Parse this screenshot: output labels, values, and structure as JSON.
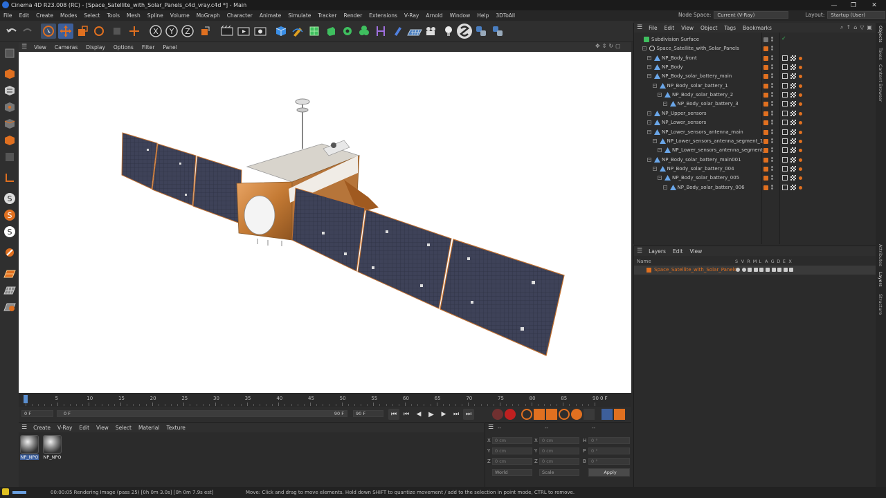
{
  "titlebar": {
    "title": "Cinema 4D R23.008 (RC) - [Space_Satellite_with_Solar_Panels_c4d_vray.c4d *] - Main",
    "minimize": "—",
    "maximize": "❐",
    "close": "✕"
  },
  "menubar": {
    "items": [
      "File",
      "Edit",
      "Create",
      "Modes",
      "Select",
      "Tools",
      "Mesh",
      "Spline",
      "Volume",
      "MoGraph",
      "Character",
      "Animate",
      "Simulate",
      "Tracker",
      "Render",
      "Extensions",
      "V-Ray",
      "Arnold",
      "Window",
      "Help",
      "3DToAll"
    ]
  },
  "nodespace": {
    "label": "Node Space:",
    "value": "Current (V-Ray)"
  },
  "layout": {
    "label": "Layout:",
    "value": "Startup (User)"
  },
  "viewport_menu": {
    "items": [
      "View",
      "Cameras",
      "Display",
      "Options",
      "Filter",
      "Panel"
    ]
  },
  "object_menu": {
    "items": [
      "File",
      "Edit",
      "View",
      "Object",
      "Tags",
      "Bookmarks"
    ]
  },
  "objects": [
    {
      "name": "Subdivision Surface",
      "depth": 0,
      "type": "subdiv"
    },
    {
      "name": "Space_Satellite_with_Solar_Panels",
      "depth": 1,
      "type": "null"
    },
    {
      "name": "NP_Body_front",
      "depth": 2,
      "type": "poly"
    },
    {
      "name": "NP_Body",
      "depth": 2,
      "type": "poly"
    },
    {
      "name": "NP_Body_solar_battery_main",
      "depth": 2,
      "type": "poly"
    },
    {
      "name": "NP_Body_solar_battery_1",
      "depth": 3,
      "type": "poly"
    },
    {
      "name": "NP_Body_solar_battery_2",
      "depth": 4,
      "type": "poly"
    },
    {
      "name": "NP_Body_solar_battery_3",
      "depth": 5,
      "type": "poly"
    },
    {
      "name": "NP_Upper_sensors",
      "depth": 2,
      "type": "poly"
    },
    {
      "name": "NP_Lower_sensors",
      "depth": 2,
      "type": "poly"
    },
    {
      "name": "NP_Lower_sensors_antenna_main",
      "depth": 2,
      "type": "poly"
    },
    {
      "name": "NP_Lower_sensors_antenna_segment_1",
      "depth": 3,
      "type": "poly"
    },
    {
      "name": "NP_Lower_sensors_antenna_segment_2",
      "depth": 4,
      "type": "poly"
    },
    {
      "name": "NP_Body_solar_battery_main001",
      "depth": 2,
      "type": "poly"
    },
    {
      "name": "NP_Body_solar_battery_004",
      "depth": 3,
      "type": "poly"
    },
    {
      "name": "NP_Body_solar_battery_005",
      "depth": 4,
      "type": "poly"
    },
    {
      "name": "NP_Body_solar_battery_006",
      "depth": 5,
      "type": "poly"
    }
  ],
  "layers_menu": {
    "items": [
      "Layers",
      "Edit",
      "View"
    ]
  },
  "layers_header": {
    "name": "Name",
    "flags": [
      "S",
      "V",
      "R",
      "M",
      "L",
      "A",
      "G",
      "D",
      "E",
      "X"
    ]
  },
  "layers": [
    {
      "name": "Space_Satellite_with_Solar_Panels",
      "color": "#e07020"
    }
  ],
  "right_tabs": [
    "Objects",
    "Takes",
    "Content Browser",
    "Attributes",
    "Layers",
    "Structure"
  ],
  "timeline": {
    "ticks": [
      "0",
      "5",
      "10",
      "15",
      "20",
      "25",
      "30",
      "35",
      "40",
      "45",
      "50",
      "55",
      "60",
      "65",
      "70",
      "75",
      "80",
      "85",
      "90"
    ],
    "current_frame": "0 F"
  },
  "transport": {
    "start": "0 F",
    "range_start": "0 F",
    "range_end": "90 F",
    "end": "90 F"
  },
  "material_menu": {
    "items": [
      "Create",
      "V-Ray",
      "Edit",
      "View",
      "Select",
      "Material",
      "Texture"
    ]
  },
  "materials": [
    {
      "name": "NP_NPO"
    },
    {
      "name": "NP_NPO"
    }
  ],
  "coords": {
    "header_a": "--",
    "header_b": "--",
    "header_c": "--",
    "rows": [
      {
        "a_label": "X",
        "a_val": "0 cm",
        "b_label": "X",
        "b_val": "0 cm",
        "c_label": "H",
        "c_val": "0 °"
      },
      {
        "a_label": "Y",
        "a_val": "0 cm",
        "b_label": "Y",
        "b_val": "0 cm",
        "c_label": "P",
        "c_val": "0 °"
      },
      {
        "a_label": "Z",
        "a_val": "0 cm",
        "b_label": "Z",
        "b_val": "0 cm",
        "c_label": "B",
        "c_val": "0 °"
      }
    ],
    "world": "World",
    "scale": "Scale",
    "apply": "Apply"
  },
  "status": {
    "render": "00:00:05 Rendering Image (pass 25) [0h  0m  3.0s] [0h  0m  7.9s est]",
    "hint": "Move: Click and drag to move elements. Hold down SHIFT to quantize movement / add to the selection in point mode, CTRL to remove.",
    "render_progress": 0.25
  },
  "colors": {
    "accent_orange": "#e07020",
    "accent_blue": "#2b6cd6",
    "bg": "#2b2b2b"
  }
}
